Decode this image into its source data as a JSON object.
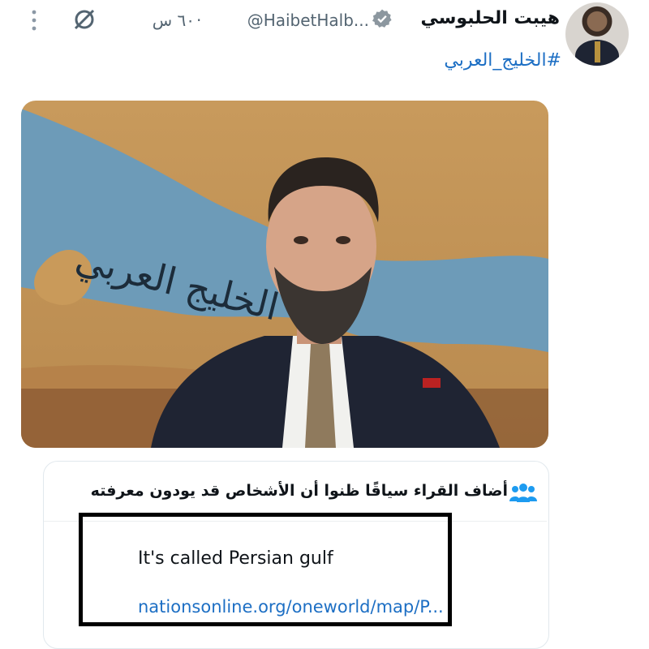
{
  "tweet": {
    "display_name": "هيبت الحلبوسي",
    "handle": "@HaibetHalb...",
    "separator": "·",
    "time": "٦٠ س",
    "hashtag": "#الخليج_العربي",
    "image_caption": "الخليج العربي",
    "icons": [
      "avatar",
      "verified-badge-icon",
      "grok-icon",
      "more-icon"
    ]
  },
  "community_note": {
    "header": "أضاف القراء سياقًا ظنوا أن الأشخاص قد يودون معرفته",
    "body": "It's called Persian gulf",
    "link": "nationsonline.org/oneworld/map/P..."
  },
  "colors": {
    "link": "#1d6fc4",
    "secondary_text": "#536471",
    "note_icon": "#1d9bf0",
    "highlight_box": "#000000"
  }
}
